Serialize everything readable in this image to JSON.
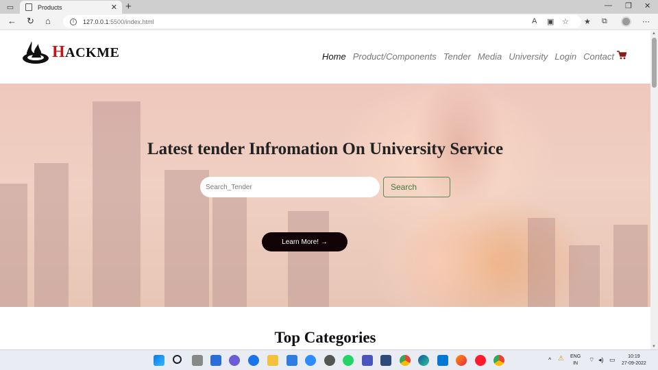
{
  "browser": {
    "tab_title": "Products",
    "url_host": "127.0.0.1",
    "url_path": ":5500/index.html"
  },
  "site": {
    "logo_initial": "H",
    "logo_rest": "ACKME",
    "nav": [
      "Home",
      "Product/Components",
      "Tender",
      "Media",
      "University",
      "Login",
      "Contact"
    ],
    "active_nav": "Home"
  },
  "hero": {
    "title": "Latest tender Infromation On University Service",
    "search_placeholder": "Search_Tender",
    "search_button": "Search",
    "cta": "Learn More! →"
  },
  "sections": {
    "top_categories": "Top Categories"
  },
  "taskbar": {
    "lang_top": "ENG",
    "lang_bottom": "IN",
    "time": "10:19",
    "date": "27-09-2022"
  },
  "colors": {
    "brand_red": "#c0151a",
    "cta_bg": "#120406",
    "search_green": "#3f7a3f",
    "cart": "#8b1a1a"
  }
}
